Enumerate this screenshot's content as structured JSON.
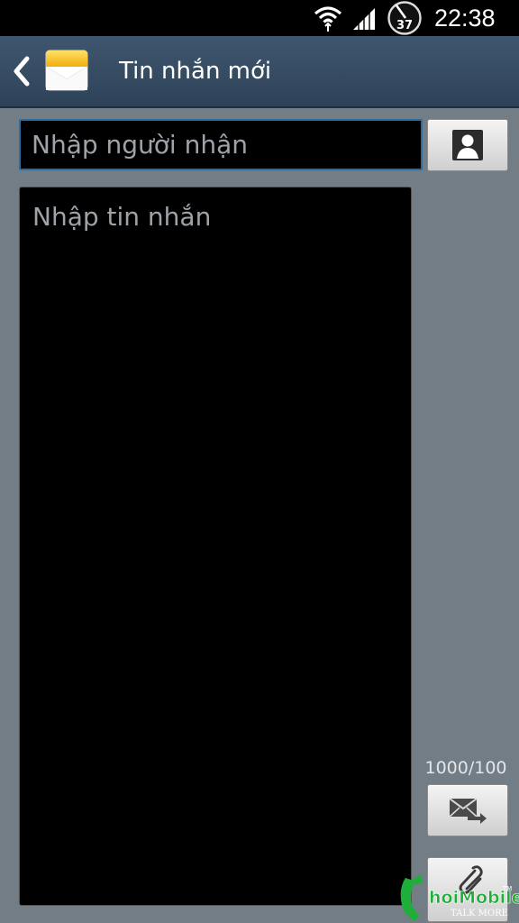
{
  "status_bar": {
    "time": "22:38",
    "battery_level": "37",
    "icons": [
      "wifi-icon",
      "signal-icon",
      "battery-icon"
    ]
  },
  "header": {
    "title": "Tin nhắn mới",
    "back_icon": "back-arrow-icon",
    "app_icon": "envelope-icon"
  },
  "composer": {
    "recipient_placeholder": "Nhập người nhận",
    "recipient_value": "",
    "message_placeholder": "Nhập tin nhắn",
    "message_value": "",
    "char_counter": "1000/100",
    "contact_icon": "contact-icon",
    "send_icon": "send-icon",
    "attach_icon": "paperclip-icon"
  },
  "watermark": {
    "brand": "ThoiMobile",
    "tagline": "TALK MORE"
  },
  "colors": {
    "background": "#737d86",
    "action_bar": "#354b62",
    "input_border": "#2f6c9c",
    "placeholder_text": "#9da3a8"
  }
}
